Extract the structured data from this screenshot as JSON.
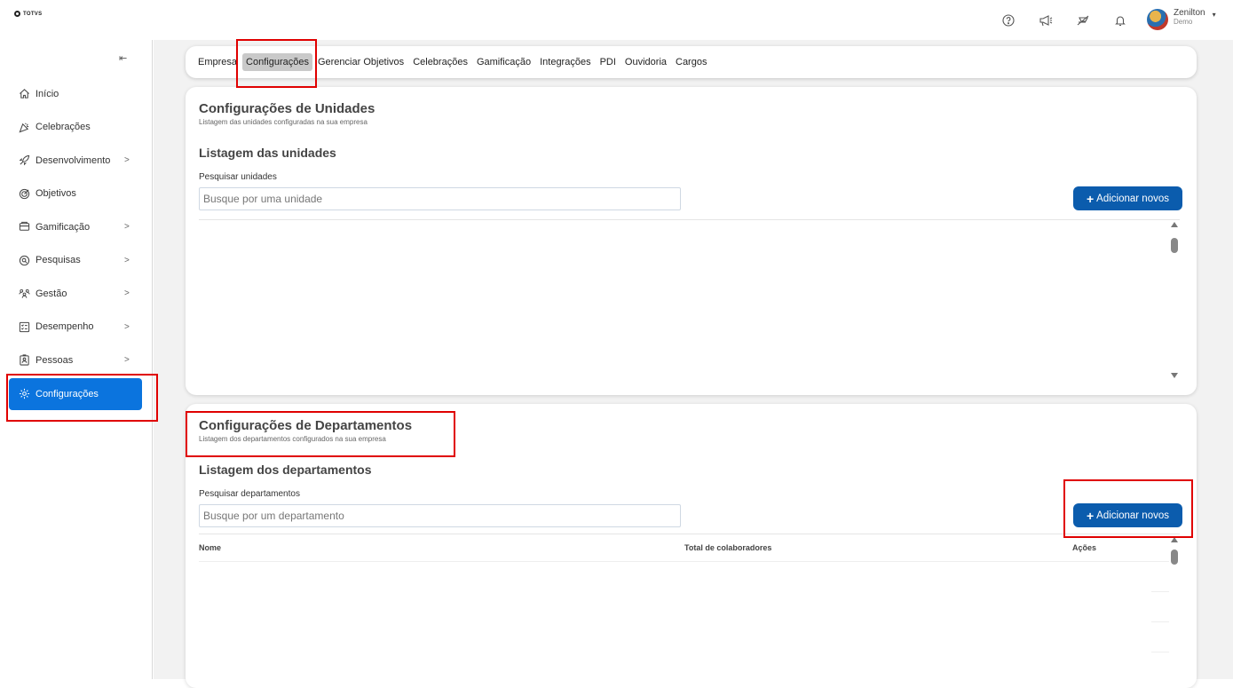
{
  "app": {
    "logo_text": "TOTVS"
  },
  "header": {
    "icons": [
      "help-icon",
      "megaphone-icon",
      "feedback-icon",
      "bell-icon"
    ],
    "user": {
      "name": "Zenilton",
      "subtitle": "Demo"
    }
  },
  "sidebar": {
    "collapse_icon": "collapse-arrow-icon",
    "items": [
      {
        "label": "Início",
        "icon": "home-icon",
        "has_chevron": false
      },
      {
        "label": "Celebrações",
        "icon": "party-icon",
        "has_chevron": false
      },
      {
        "label": "Desenvolvimento",
        "icon": "rocket-icon",
        "has_chevron": true
      },
      {
        "label": "Objetivos",
        "icon": "target-icon",
        "has_chevron": false
      },
      {
        "label": "Gamificação",
        "icon": "coins-icon",
        "has_chevron": true
      },
      {
        "label": "Pesquisas",
        "icon": "survey-icon",
        "has_chevron": true
      },
      {
        "label": "Gestão",
        "icon": "people-icon",
        "has_chevron": true
      },
      {
        "label": "Desempenho",
        "icon": "checklist-icon",
        "has_chevron": true
      },
      {
        "label": "Pessoas",
        "icon": "badge-icon",
        "has_chevron": true
      },
      {
        "label": "Configurações",
        "icon": "gear-icon",
        "has_chevron": false,
        "active": true
      }
    ]
  },
  "tabs": [
    "Empresa",
    "Configurações",
    "Gerenciar Objetivos",
    "Celebrações",
    "Gamificação",
    "Integrações",
    "PDI",
    "Ouvidoria",
    "Cargos"
  ],
  "selected_tab": "Configurações",
  "units_card": {
    "title": "Configurações de Unidades",
    "subtitle": "Listagem das unidades configuradas na sua empresa",
    "list_title": "Listagem das unidades",
    "search_label": "Pesquisar unidades",
    "search_placeholder": "Busque por uma unidade",
    "add_button": "Adicionar novos"
  },
  "departments_card": {
    "title": "Configurações de Departamentos",
    "subtitle": "Listagem dos departamentos configurados na sua empresa",
    "list_title": "Listagem dos departamentos",
    "search_label": "Pesquisar departamentos",
    "search_placeholder": "Busque por um departamento",
    "add_button": "Adicionar novos",
    "columns": [
      "Nome",
      "Total de colaboradores",
      "Ações"
    ]
  },
  "colors": {
    "accent": "#0b74de",
    "button": "#0b5cad",
    "highlight": "#e00000"
  }
}
